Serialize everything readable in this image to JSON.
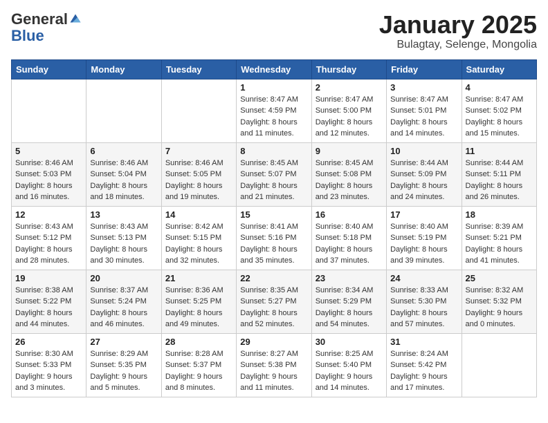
{
  "header": {
    "logo_general": "General",
    "logo_blue": "Blue",
    "month_title": "January 2025",
    "location": "Bulagtay, Selenge, Mongolia"
  },
  "days_of_week": [
    "Sunday",
    "Monday",
    "Tuesday",
    "Wednesday",
    "Thursday",
    "Friday",
    "Saturday"
  ],
  "weeks": [
    [
      {
        "day": "",
        "info": ""
      },
      {
        "day": "",
        "info": ""
      },
      {
        "day": "",
        "info": ""
      },
      {
        "day": "1",
        "info": "Sunrise: 8:47 AM\nSunset: 4:59 PM\nDaylight: 8 hours\nand 11 minutes."
      },
      {
        "day": "2",
        "info": "Sunrise: 8:47 AM\nSunset: 5:00 PM\nDaylight: 8 hours\nand 12 minutes."
      },
      {
        "day": "3",
        "info": "Sunrise: 8:47 AM\nSunset: 5:01 PM\nDaylight: 8 hours\nand 14 minutes."
      },
      {
        "day": "4",
        "info": "Sunrise: 8:47 AM\nSunset: 5:02 PM\nDaylight: 8 hours\nand 15 minutes."
      }
    ],
    [
      {
        "day": "5",
        "info": "Sunrise: 8:46 AM\nSunset: 5:03 PM\nDaylight: 8 hours\nand 16 minutes."
      },
      {
        "day": "6",
        "info": "Sunrise: 8:46 AM\nSunset: 5:04 PM\nDaylight: 8 hours\nand 18 minutes."
      },
      {
        "day": "7",
        "info": "Sunrise: 8:46 AM\nSunset: 5:05 PM\nDaylight: 8 hours\nand 19 minutes."
      },
      {
        "day": "8",
        "info": "Sunrise: 8:45 AM\nSunset: 5:07 PM\nDaylight: 8 hours\nand 21 minutes."
      },
      {
        "day": "9",
        "info": "Sunrise: 8:45 AM\nSunset: 5:08 PM\nDaylight: 8 hours\nand 23 minutes."
      },
      {
        "day": "10",
        "info": "Sunrise: 8:44 AM\nSunset: 5:09 PM\nDaylight: 8 hours\nand 24 minutes."
      },
      {
        "day": "11",
        "info": "Sunrise: 8:44 AM\nSunset: 5:11 PM\nDaylight: 8 hours\nand 26 minutes."
      }
    ],
    [
      {
        "day": "12",
        "info": "Sunrise: 8:43 AM\nSunset: 5:12 PM\nDaylight: 8 hours\nand 28 minutes."
      },
      {
        "day": "13",
        "info": "Sunrise: 8:43 AM\nSunset: 5:13 PM\nDaylight: 8 hours\nand 30 minutes."
      },
      {
        "day": "14",
        "info": "Sunrise: 8:42 AM\nSunset: 5:15 PM\nDaylight: 8 hours\nand 32 minutes."
      },
      {
        "day": "15",
        "info": "Sunrise: 8:41 AM\nSunset: 5:16 PM\nDaylight: 8 hours\nand 35 minutes."
      },
      {
        "day": "16",
        "info": "Sunrise: 8:40 AM\nSunset: 5:18 PM\nDaylight: 8 hours\nand 37 minutes."
      },
      {
        "day": "17",
        "info": "Sunrise: 8:40 AM\nSunset: 5:19 PM\nDaylight: 8 hours\nand 39 minutes."
      },
      {
        "day": "18",
        "info": "Sunrise: 8:39 AM\nSunset: 5:21 PM\nDaylight: 8 hours\nand 41 minutes."
      }
    ],
    [
      {
        "day": "19",
        "info": "Sunrise: 8:38 AM\nSunset: 5:22 PM\nDaylight: 8 hours\nand 44 minutes."
      },
      {
        "day": "20",
        "info": "Sunrise: 8:37 AM\nSunset: 5:24 PM\nDaylight: 8 hours\nand 46 minutes."
      },
      {
        "day": "21",
        "info": "Sunrise: 8:36 AM\nSunset: 5:25 PM\nDaylight: 8 hours\nand 49 minutes."
      },
      {
        "day": "22",
        "info": "Sunrise: 8:35 AM\nSunset: 5:27 PM\nDaylight: 8 hours\nand 52 minutes."
      },
      {
        "day": "23",
        "info": "Sunrise: 8:34 AM\nSunset: 5:29 PM\nDaylight: 8 hours\nand 54 minutes."
      },
      {
        "day": "24",
        "info": "Sunrise: 8:33 AM\nSunset: 5:30 PM\nDaylight: 8 hours\nand 57 minutes."
      },
      {
        "day": "25",
        "info": "Sunrise: 8:32 AM\nSunset: 5:32 PM\nDaylight: 9 hours\nand 0 minutes."
      }
    ],
    [
      {
        "day": "26",
        "info": "Sunrise: 8:30 AM\nSunset: 5:33 PM\nDaylight: 9 hours\nand 3 minutes."
      },
      {
        "day": "27",
        "info": "Sunrise: 8:29 AM\nSunset: 5:35 PM\nDaylight: 9 hours\nand 5 minutes."
      },
      {
        "day": "28",
        "info": "Sunrise: 8:28 AM\nSunset: 5:37 PM\nDaylight: 9 hours\nand 8 minutes."
      },
      {
        "day": "29",
        "info": "Sunrise: 8:27 AM\nSunset: 5:38 PM\nDaylight: 9 hours\nand 11 minutes."
      },
      {
        "day": "30",
        "info": "Sunrise: 8:25 AM\nSunset: 5:40 PM\nDaylight: 9 hours\nand 14 minutes."
      },
      {
        "day": "31",
        "info": "Sunrise: 8:24 AM\nSunset: 5:42 PM\nDaylight: 9 hours\nand 17 minutes."
      },
      {
        "day": "",
        "info": ""
      }
    ]
  ]
}
